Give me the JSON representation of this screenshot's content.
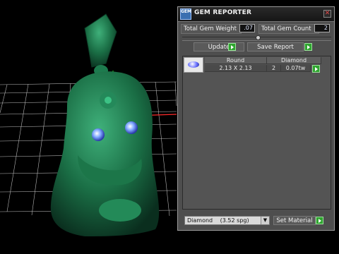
{
  "panel": {
    "title": "GEM REPORTER",
    "logo_text": "GEM",
    "close_glyph": "✕",
    "stats": {
      "weight_label": "Total Gem Weight",
      "weight_value": ".07",
      "count_label": "Total Gem Count",
      "count_value": "2"
    },
    "buttons": {
      "update": "Update",
      "save_report": "Save Report",
      "set_material": "Set Material"
    },
    "table": {
      "headers": [
        "Round",
        "Diamond"
      ],
      "row": {
        "size": "2.13 X 2.13",
        "count": "2",
        "weight": "0.07tw"
      }
    },
    "material_select": {
      "value": "Diamond",
      "detail": "(3.52 spg)"
    }
  },
  "colors": {
    "accent_green": "#2fa52f",
    "model_green": "#1f7a4f",
    "gem_blue": "#6c74ff"
  },
  "icons": [
    "gem-logo-icon",
    "close-icon",
    "play-icon",
    "dropdown-arrow-icon",
    "gem-thumbnail-icon"
  ]
}
